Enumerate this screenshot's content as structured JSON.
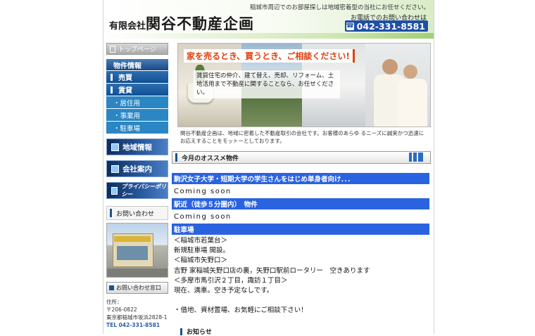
{
  "header": {
    "company_small": "有限会社",
    "company_big": "関谷不動産企画",
    "tagline": "稲城市周辺でのお部屋探しは地域密着型の当社にお任せください。",
    "phone_label": "お電話でのお問い合わせは",
    "phone": "042-331-8581"
  },
  "sidebar": {
    "top_page": "トップページ",
    "section_label": "物件情報",
    "items": [
      {
        "label": "売買"
      },
      {
        "label": "賃貸"
      }
    ],
    "sub_items": [
      {
        "label": "・居住用"
      },
      {
        "label": "・事業用"
      },
      {
        "label": "・駐車場"
      }
    ],
    "banners": [
      {
        "label": "地域情報"
      },
      {
        "label": "会社案内"
      },
      {
        "label": "プライバシーポリシー"
      }
    ],
    "contact_head": "お問い合わせ",
    "contact_button": "お問い合わせ窓口",
    "address_label": "住所：",
    "postal": "〒206-0822",
    "address": "東京都稲城市坂浜2828-1",
    "tel": "TEL 042-331-8581"
  },
  "main": {
    "hero_title": "家を売るとき、買うとき、ご相談ください!",
    "hero_text": "賃貸住宅の仲介、建て替え、売却、リフォーム、土地活用まで不動産に関することなら、お任せください。",
    "intro": "関谷不動産企画は、地域に密着した不動産取引の会社です。お客様のあらゆ るニーズに誠実かつ迅速にお応えすることをモットーとしております。",
    "section_title": "今月のオススメ物件",
    "rows": [
      {
        "title": "駒沢女子大学・短期大学の学生さんをはじめ単身者向け．．．",
        "body": "Coming soon"
      },
      {
        "title": "駅近（徒歩５分圏内）　物件",
        "body": "Coming soon"
      },
      {
        "title": "駐車場"
      }
    ],
    "notes": [
      "＜稲城市若葉台＞",
      "新規駐車場 開設。",
      "＜稲城市矢野口＞",
      "吉野 家稲城矢野口店の裏，矢野口駅前ロータリー　空きあります",
      "＜多摩市馬引沢２丁目，諏訪１丁目＞",
      "現在、満車。空き予定なしです。",
      "",
      "・借地、資材置場、お気軽にご相談下さい！"
    ],
    "footer_head": "お知らせ"
  },
  "colors": {
    "accent_blue": "#2a63e0",
    "nav_blue": "#0f4f94",
    "hero_title": "#e0410f"
  }
}
